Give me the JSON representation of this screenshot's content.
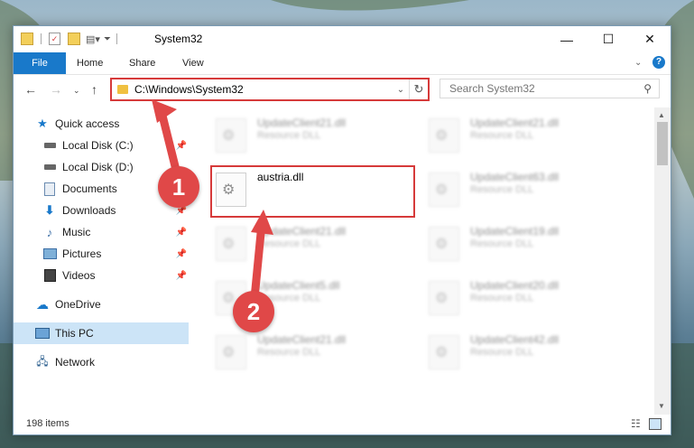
{
  "window": {
    "title": "System32",
    "controls": {
      "minimize": "—",
      "maximize": "☐",
      "close": "✕"
    }
  },
  "ribbon": {
    "tabs": [
      "File",
      "Home",
      "Share",
      "View"
    ],
    "expand_icon": "chevron-down-icon",
    "help_icon": "help-icon"
  },
  "navigation": {
    "address_path": "C:\\Windows\\System32",
    "search_placeholder": "Search System32"
  },
  "sidebar": {
    "items": [
      {
        "label": "Quick access",
        "icon": "star-icon",
        "pinned": false
      },
      {
        "label": "Local Disk (C:)",
        "icon": "drive-icon",
        "pinned": true
      },
      {
        "label": "Local Disk (D:)",
        "icon": "drive-icon",
        "pinned": true
      },
      {
        "label": "Documents",
        "icon": "documents-icon",
        "pinned": true
      },
      {
        "label": "Downloads",
        "icon": "download-icon",
        "pinned": true
      },
      {
        "label": "Music",
        "icon": "music-icon",
        "pinned": true
      },
      {
        "label": "Pictures",
        "icon": "pictures-icon",
        "pinned": true
      },
      {
        "label": "Videos",
        "icon": "videos-icon",
        "pinned": true
      },
      {
        "label": "OneDrive",
        "icon": "cloud-icon",
        "pinned": false
      },
      {
        "label": "This PC",
        "icon": "computer-icon",
        "pinned": false,
        "selected": true
      },
      {
        "label": "Network",
        "icon": "network-icon",
        "pinned": false
      }
    ]
  },
  "files": [
    {
      "name": "UpdateClient21.dll",
      "type": "Resource DLL"
    },
    {
      "name": "UpdateClient21.dll",
      "type": "Resource DLL"
    },
    {
      "name": "austria.dll",
      "type": ""
    },
    {
      "name": "UpdateClient63.dll",
      "type": "Resource DLL"
    },
    {
      "name": "UpdateClient21.dll",
      "type": "Resource DLL"
    },
    {
      "name": "UpdateClient19.dll",
      "type": "Resource DLL"
    },
    {
      "name": "UpdateClient5.dll",
      "type": "Resource DLL"
    },
    {
      "name": "UpdateClient20.dll",
      "type": "Resource DLL"
    },
    {
      "name": "UpdateClient21.dll",
      "type": "Resource DLL"
    },
    {
      "name": "UpdateClient42.dll",
      "type": "Resource DLL"
    }
  ],
  "status": {
    "item_count": "198 items"
  },
  "annotations": {
    "step1": "1",
    "step2": "2"
  },
  "colors": {
    "highlight": "#d63a3a",
    "accent": "#1979ca"
  }
}
